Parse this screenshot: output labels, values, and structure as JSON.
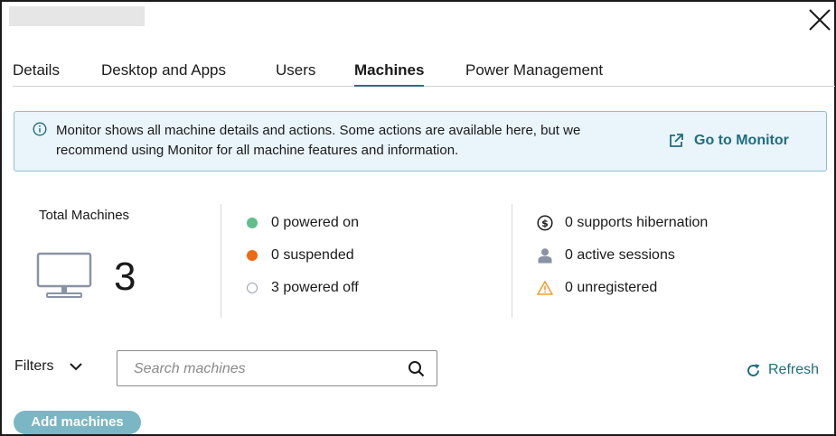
{
  "tabs": [
    {
      "label": "Details"
    },
    {
      "label": "Desktop and Apps"
    },
    {
      "label": "Users"
    },
    {
      "label": "Machines",
      "active": true
    },
    {
      "label": "Power Management"
    }
  ],
  "banner": {
    "icon": "info-icon",
    "message": "Monitor shows all machine details and actions. Some actions are available here, but we recommend using Monitor for all machine features and information.",
    "link_label": "Go to Monitor",
    "link_icon": "external-link-icon"
  },
  "summary": {
    "total_label": "Total Machines",
    "total_count": "3",
    "power_stats": [
      {
        "label": "0 powered on",
        "color": "#5fbf8c"
      },
      {
        "label": "0 suspended",
        "color": "#f0690f"
      },
      {
        "label": "3 powered off",
        "color": "#9aa3b5"
      }
    ],
    "other_stats": [
      {
        "label": "0 supports hibernation",
        "icon": "dollar-circle-icon"
      },
      {
        "label": "0 active sessions",
        "icon": "user-icon"
      },
      {
        "label": "0 unregistered",
        "icon": "warning-icon"
      }
    ]
  },
  "toolbar": {
    "filters_label": "Filters",
    "search_placeholder": "Search machines",
    "search_value": "",
    "refresh_label": "Refresh",
    "add_label": "Add machines"
  },
  "colors": {
    "accent": "#1f6e7e",
    "banner_bg": "#eaf4fb",
    "banner_border": "#8cc0d6",
    "add_button": "#7ab6c4",
    "warning": "#f0a030"
  }
}
